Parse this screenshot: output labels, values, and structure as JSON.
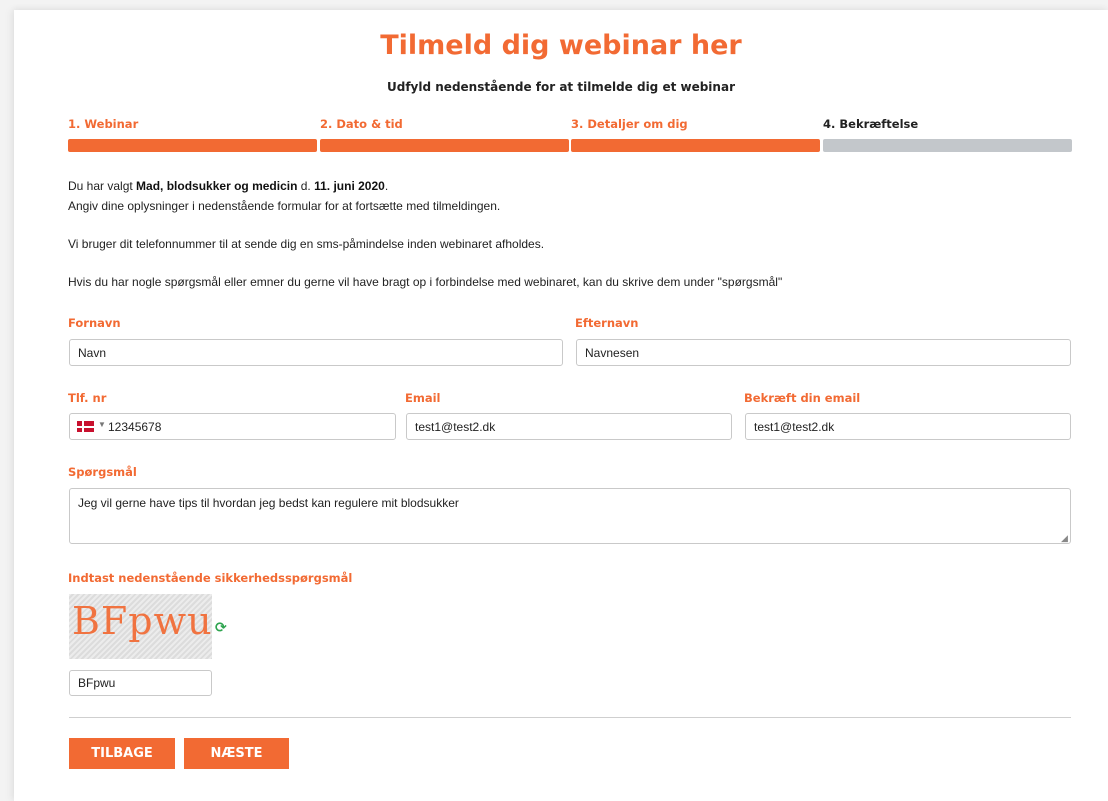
{
  "header": {
    "title": "Tilmeld dig webinar her",
    "subtitle": "Udfyld nedenstående for at tilmelde dig et webinar"
  },
  "steps": [
    {
      "label": "1. Webinar",
      "state": "done"
    },
    {
      "label": "2. Dato & tid",
      "state": "done"
    },
    {
      "label": "3. Detaljer om dig",
      "state": "done"
    },
    {
      "label": "4. Bekræftelse",
      "state": "pending"
    }
  ],
  "intro": {
    "line1_prefix": "Du har valgt ",
    "webinar_name": "Mad, blodsukker og medicin",
    "line1_mid": " d. ",
    "webinar_date": "11. juni 2020",
    "line1_suffix": ".",
    "line2": "Angiv dine oplysninger i nedenstående formular for at fortsætte med tilmeldingen.",
    "line3": "Vi bruger dit telefonnummer til at sende dig en sms-påmindelse inden webinaret afholdes.",
    "line4": "Hvis du har nogle spørgsmål eller emner du gerne vil have bragt op i forbindelse med webinaret, kan du skrive dem under \"spørgsmål\""
  },
  "form": {
    "firstname": {
      "label": "Fornavn",
      "value": "Navn"
    },
    "lastname": {
      "label": "Efternavn",
      "value": "Navnesen"
    },
    "phone": {
      "label": "Tlf. nr",
      "value": "12345678",
      "country_icon": "denmark-flag-icon"
    },
    "email": {
      "label": "Email",
      "value": "test1@test2.dk"
    },
    "email_confirm": {
      "label": "Bekræft din email",
      "value": "test1@test2.dk"
    },
    "question": {
      "label": "Spørgsmål",
      "value": "Jeg vil gerne have tips til hvordan jeg bedst kan regulere mit blodsukker"
    },
    "captcha": {
      "label": "Indtast nedenstående sikkerhedsspørgsmål",
      "image_text": "BFpwu",
      "value": "BFpwu",
      "refresh_icon": "refresh-icon"
    }
  },
  "buttons": {
    "back": "TILBAGE",
    "next": "NÆSTE"
  },
  "colors": {
    "accent": "#f26a33",
    "pending": "#c3c7cb",
    "refresh": "#2ea44f"
  }
}
